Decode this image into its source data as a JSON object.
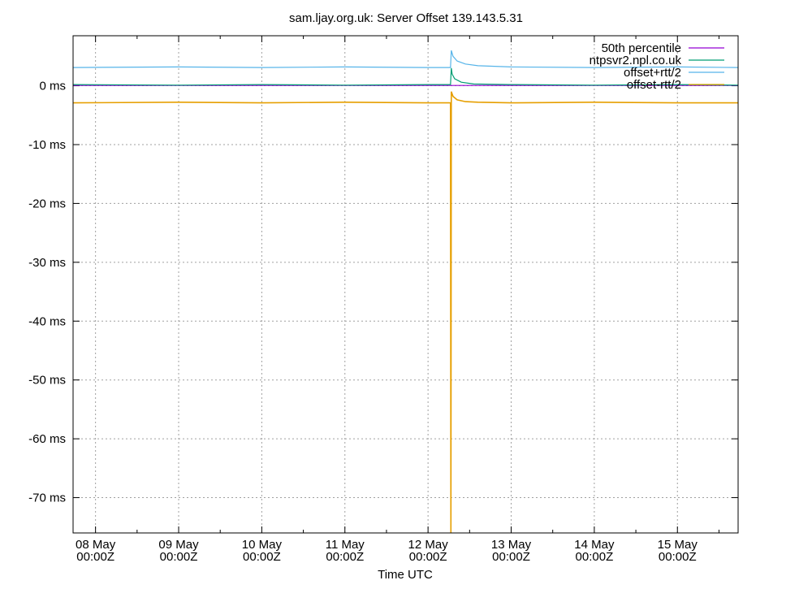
{
  "chart_data": {
    "type": "line",
    "title": "sam.ljay.org.uk: Server Offset 139.143.5.31",
    "xlabel": "Time UTC",
    "ylabel": "",
    "x_unit": "days",
    "xlim": [
      -0.27,
      7.73
    ],
    "ylim": [
      -76,
      8.5
    ],
    "y_ticks": [
      {
        "value": 0,
        "label": "0 ms"
      },
      {
        "value": -10,
        "label": "-10 ms"
      },
      {
        "value": -20,
        "label": "-20 ms"
      },
      {
        "value": -30,
        "label": "-30 ms"
      },
      {
        "value": -40,
        "label": "-40 ms"
      },
      {
        "value": -50,
        "label": "-50 ms"
      },
      {
        "value": -60,
        "label": "-60 ms"
      },
      {
        "value": -70,
        "label": "-70 ms"
      }
    ],
    "x_ticks": [
      {
        "value": 0,
        "line1": "08 May",
        "line2": "00:00Z"
      },
      {
        "value": 1,
        "line1": "09 May",
        "line2": "00:00Z"
      },
      {
        "value": 2,
        "line1": "10 May",
        "line2": "00:00Z"
      },
      {
        "value": 3,
        "line1": "11 May",
        "line2": "00:00Z"
      },
      {
        "value": 4,
        "line1": "12 May",
        "line2": "00:00Z"
      },
      {
        "value": 5,
        "line1": "13 May",
        "line2": "00:00Z"
      },
      {
        "value": 6,
        "line1": "14 May",
        "line2": "00:00Z"
      },
      {
        "value": 7,
        "line1": "15 May",
        "line2": "00:00Z"
      }
    ],
    "grid": true,
    "legend_position": "top-right",
    "series": [
      {
        "name": "50th percentile",
        "color": "#9400d3",
        "x": [
          -0.27,
          7.73
        ],
        "y": [
          0.05,
          0.05
        ]
      },
      {
        "name": "ntpsvr2.npl.co.uk",
        "color": "#009e73",
        "x": [
          -0.27,
          1.0,
          2.0,
          3.0,
          4.0,
          4.27,
          4.28,
          4.29,
          4.32,
          4.4,
          4.55,
          5.0,
          6.0,
          7.0,
          7.73
        ],
        "y": [
          0.2,
          0.1,
          0.2,
          0.1,
          0.2,
          0.2,
          3.0,
          2.0,
          1.2,
          0.6,
          0.3,
          0.2,
          0.1,
          0.2,
          0.1
        ]
      },
      {
        "name": "offset+rtt/2",
        "color": "#56b4e9",
        "x": [
          -0.27,
          1.0,
          2.0,
          3.0,
          4.0,
          4.27,
          4.28,
          4.3,
          4.35,
          4.45,
          4.6,
          5.0,
          6.0,
          7.0,
          7.73
        ],
        "y": [
          3.1,
          3.2,
          3.1,
          3.2,
          3.1,
          3.1,
          6.0,
          5.0,
          4.2,
          3.7,
          3.4,
          3.2,
          3.1,
          3.2,
          3.1
        ]
      },
      {
        "name": "offset-rtt/2",
        "color": "#e69f00",
        "x": [
          -0.27,
          1.0,
          2.0,
          3.0,
          4.0,
          4.27,
          4.275,
          4.28,
          4.3,
          4.35,
          4.45,
          4.6,
          5.0,
          6.0,
          7.0,
          7.73
        ],
        "y": [
          -2.9,
          -2.8,
          -2.9,
          -2.8,
          -2.9,
          -2.9,
          -76.0,
          -1.0,
          -1.8,
          -2.4,
          -2.7,
          -2.8,
          -2.9,
          -2.8,
          -2.9,
          -2.9
        ]
      }
    ]
  }
}
